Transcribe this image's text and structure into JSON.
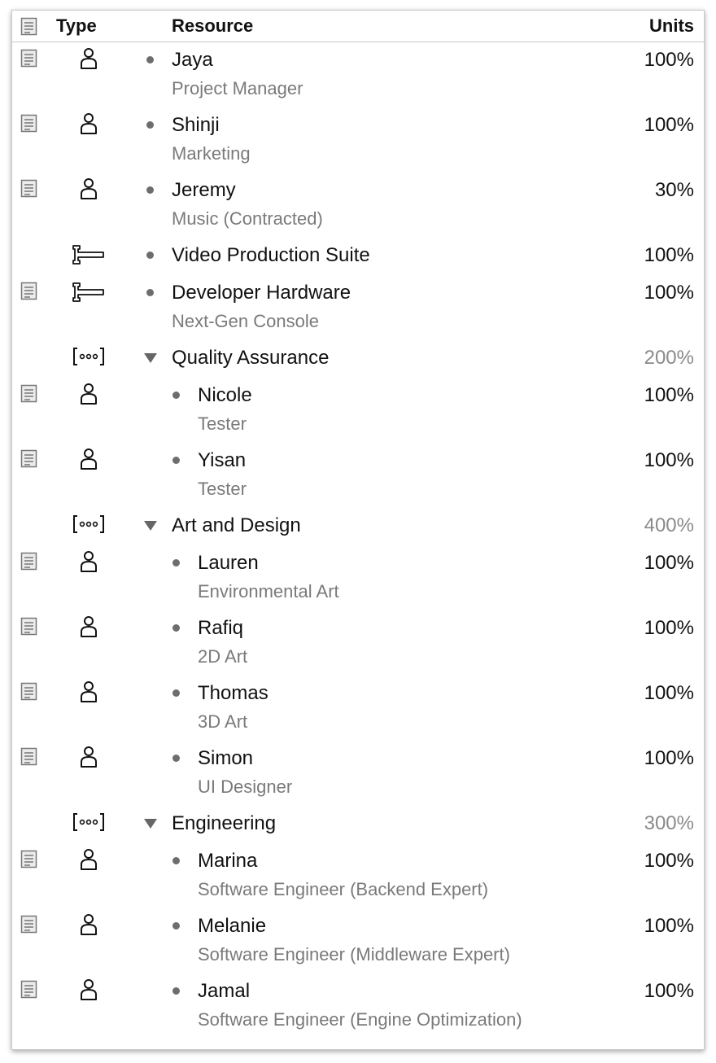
{
  "header": {
    "type_label": "Type",
    "resource_label": "Resource",
    "units_label": "Units"
  },
  "rows": [
    {
      "level": 0,
      "kind": "person",
      "note": true,
      "name": "Jaya",
      "subtitle": "Project Manager",
      "units": "100%"
    },
    {
      "level": 0,
      "kind": "person",
      "note": true,
      "name": "Shinji",
      "subtitle": "Marketing",
      "units": "100%"
    },
    {
      "level": 0,
      "kind": "person",
      "note": true,
      "name": "Jeremy",
      "subtitle": "Music (Contracted)",
      "units": "30%"
    },
    {
      "level": 0,
      "kind": "equipment",
      "note": false,
      "name": "Video Production Suite",
      "subtitle": "",
      "units": "100%"
    },
    {
      "level": 0,
      "kind": "equipment",
      "note": true,
      "name": "Developer Hardware",
      "subtitle": "Next-Gen Console",
      "units": "100%"
    },
    {
      "level": 0,
      "kind": "group",
      "note": false,
      "name": "Quality Assurance",
      "subtitle": "",
      "units": "200%"
    },
    {
      "level": 1,
      "kind": "person",
      "note": true,
      "name": "Nicole",
      "subtitle": "Tester",
      "units": "100%"
    },
    {
      "level": 1,
      "kind": "person",
      "note": true,
      "name": "Yisan",
      "subtitle": "Tester",
      "units": "100%"
    },
    {
      "level": 0,
      "kind": "group",
      "note": false,
      "name": "Art and Design",
      "subtitle": "",
      "units": "400%"
    },
    {
      "level": 1,
      "kind": "person",
      "note": true,
      "name": "Lauren",
      "subtitle": "Environmental Art",
      "units": "100%"
    },
    {
      "level": 1,
      "kind": "person",
      "note": true,
      "name": "Rafiq",
      "subtitle": "2D Art",
      "units": "100%"
    },
    {
      "level": 1,
      "kind": "person",
      "note": true,
      "name": "Thomas",
      "subtitle": "3D Art",
      "units": "100%"
    },
    {
      "level": 1,
      "kind": "person",
      "note": true,
      "name": "Simon",
      "subtitle": "UI Designer",
      "units": "100%"
    },
    {
      "level": 0,
      "kind": "group",
      "note": false,
      "name": "Engineering",
      "subtitle": "",
      "units": "300%"
    },
    {
      "level": 1,
      "kind": "person",
      "note": true,
      "name": "Marina",
      "subtitle": "Software Engineer (Backend Expert)",
      "units": "100%"
    },
    {
      "level": 1,
      "kind": "person",
      "note": true,
      "name": "Melanie",
      "subtitle": "Software Engineer (Middleware Expert)",
      "units": "100%"
    },
    {
      "level": 1,
      "kind": "person",
      "note": true,
      "name": "Jamal",
      "subtitle": "Software Engineer (Engine Optimization)",
      "units": "100%"
    }
  ]
}
